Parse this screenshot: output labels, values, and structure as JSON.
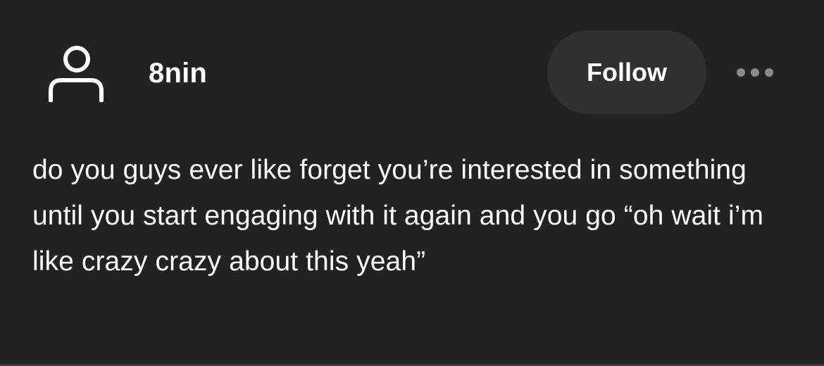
{
  "post": {
    "author": {
      "username": "8nin",
      "avatar_icon": "person-outline-icon"
    },
    "follow_label": "Follow",
    "more_icon": "more-dots-icon",
    "text": "do you guys ever like forget you’re interested in something until you start engaging with it again and you go “oh wait i’m like crazy crazy about this yeah”"
  },
  "colors": {
    "background": "#222222",
    "text": "#ffffff",
    "button_background": "#303030",
    "icon_muted": "#8a8a8a"
  }
}
